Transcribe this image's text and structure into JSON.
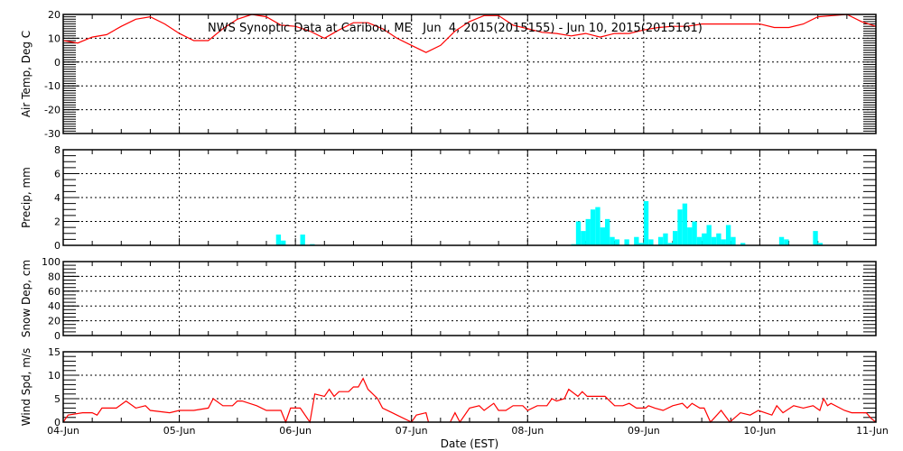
{
  "chart_data": [
    {
      "type": "line",
      "title": "NWS Synoptic Data at Caribou, ME   Jun  4, 2015(2015155) - Jun 10, 2015(2015161)",
      "ylabel": "Air Temp, Deg C",
      "ylim": [
        -30,
        20
      ],
      "yticks": [
        "-30",
        "-20",
        "-10",
        "0",
        "10",
        "20"
      ],
      "ytick_values": [
        -30,
        -20,
        -10,
        0,
        10,
        20
      ],
      "color": "#ff0000",
      "x_hours": [
        0,
        3,
        6,
        9,
        12,
        15,
        18,
        21,
        24,
        27,
        30,
        33,
        36,
        39,
        42,
        45,
        48,
        51,
        54,
        57,
        60,
        63,
        66,
        69,
        72,
        75,
        78,
        81,
        84,
        87,
        90,
        93,
        96,
        99,
        102,
        105,
        108,
        111,
        114,
        117,
        120,
        123,
        126,
        129,
        132,
        135,
        138,
        141,
        144,
        147,
        150,
        153,
        156,
        159,
        162,
        165,
        168
      ],
      "values": [
        9,
        8,
        10.5,
        11.5,
        15,
        18,
        19,
        16,
        12,
        9,
        9,
        14,
        18,
        20,
        19,
        15.5,
        15,
        13,
        10,
        13.5,
        16.5,
        16.5,
        14,
        10,
        7,
        4,
        7,
        13,
        17,
        19.5,
        19.5,
        15.5,
        14,
        12.5,
        12,
        11,
        12,
        10.5,
        12,
        12,
        13.5,
        14.5,
        15,
        15,
        16,
        16,
        16,
        16,
        16,
        14.5,
        14.5,
        16,
        19,
        19.5,
        20,
        17,
        15
      ]
    },
    {
      "type": "bar",
      "ylabel": "Precip, mm",
      "ylim": [
        0,
        8
      ],
      "yticks": [
        "0",
        "2",
        "4",
        "6",
        "8"
      ],
      "ytick_values": [
        0,
        2,
        4,
        6,
        8
      ],
      "color": "#00ffff",
      "x_hours": [
        44,
        45,
        49,
        51,
        105,
        106,
        107,
        108,
        109,
        110,
        111,
        112,
        113,
        114,
        116,
        118,
        119,
        120,
        121,
        123,
        124,
        125,
        126,
        127,
        128,
        129,
        130,
        131,
        132,
        133,
        134,
        135,
        136,
        137,
        138,
        140,
        148,
        149,
        155,
        156
      ],
      "values": [
        0.9,
        0.4,
        0.9,
        0.1,
        0.1,
        2.0,
        1.2,
        2.2,
        3.0,
        3.2,
        1.5,
        2.2,
        0.7,
        0.5,
        0.5,
        0.7,
        0.2,
        3.7,
        0.5,
        0.7,
        1.0,
        0.2,
        1.2,
        3.0,
        3.5,
        1.5,
        2.0,
        0.7,
        1.0,
        1.7,
        0.7,
        1.0,
        0.5,
        1.7,
        0.7,
        0.2,
        0.7,
        0.5,
        1.2,
        0.2
      ]
    },
    {
      "type": "line",
      "ylabel": "Snow Dep, cm",
      "ylim": [
        0,
        100
      ],
      "yticks": [
        "0",
        "20",
        "40",
        "60",
        "80",
        "100"
      ],
      "ytick_values": [
        0,
        20,
        40,
        60,
        80,
        100
      ],
      "color": "#ff0000",
      "x_hours": [],
      "values": []
    },
    {
      "type": "line",
      "ylabel": "Wind Spd, m/s",
      "ylim": [
        0,
        15
      ],
      "yticks": [
        "0",
        "5",
        "10",
        "15"
      ],
      "ytick_values": [
        0,
        5,
        10,
        15
      ],
      "color": "#ff0000",
      "segments": [
        {
          "x_hours": [
            0,
            1,
            4,
            6,
            7,
            8,
            9,
            11,
            13,
            15,
            17,
            18,
            22,
            24,
            27,
            30,
            31,
            33,
            35,
            36,
            37,
            40,
            42,
            45,
            46,
            47,
            49,
            51,
            52,
            54,
            55,
            56,
            57,
            59,
            60,
            61,
            62,
            63,
            65,
            66,
            68,
            69,
            72,
            73,
            75,
            75.5
          ],
          "values": [
            0,
            1.5,
            2,
            2,
            1.5,
            3,
            3,
            3,
            4.5,
            3,
            3.5,
            2.5,
            2,
            2.5,
            2.5,
            3,
            5,
            3.5,
            3.5,
            4.5,
            4.5,
            3.5,
            2.5,
            2.5,
            0,
            3,
            3,
            0,
            6,
            5.5,
            7,
            5.5,
            6.5,
            6.5,
            7.5,
            7.5,
            9.3,
            7,
            5,
            3,
            2,
            1.5,
            0,
            1.5,
            2,
            0
          ]
        },
        {
          "x_hours": [
            80,
            81,
            82,
            84,
            86,
            87,
            89,
            90,
            91.5,
            93,
            95,
            96,
            98,
            100,
            101,
            102,
            103.6,
            104.5,
            106.4,
            107.3,
            108.3,
            112,
            114,
            115.7,
            117,
            118.5,
            120.4,
            121,
            122.3,
            124,
            126,
            128,
            129,
            130,
            131.6,
            132.5,
            133.8,
            136,
            137.8,
            140,
            142,
            143.7,
            146.5,
            147.5,
            148.8,
            151,
            153,
            155,
            156.4,
            157.2,
            158,
            158.7,
            161.5,
            163,
            164.8,
            166,
            167,
            168
          ],
          "values": [
            0,
            2,
            0,
            3,
            3.5,
            2.5,
            4,
            2.5,
            2.5,
            3.5,
            3.5,
            2.5,
            3.5,
            3.5,
            5,
            4.5,
            5,
            7,
            5.5,
            6.5,
            5.5,
            5.5,
            3.5,
            3.5,
            4,
            3,
            3,
            3.5,
            3,
            2.5,
            3.5,
            4,
            3,
            4,
            3,
            3,
            0,
            2.5,
            0,
            2,
            1.5,
            2.5,
            1.5,
            3.5,
            2,
            3.5,
            3,
            3.5,
            2.5,
            5,
            3.5,
            4,
            2.5,
            2,
            2,
            2,
            0.8,
            0
          ]
        }
      ]
    }
  ],
  "xaxis": {
    "label": "Date (EST)",
    "ticks": [
      "04-Jun",
      "05-Jun",
      "06-Jun",
      "07-Jun",
      "08-Jun",
      "09-Jun",
      "10-Jun",
      "11-Jun"
    ],
    "range_hours": [
      0,
      168
    ]
  }
}
